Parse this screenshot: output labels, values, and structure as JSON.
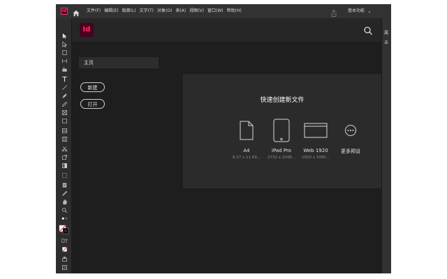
{
  "menubar": {
    "app_icon": "Id",
    "home_icon": "home-icon",
    "menus": [
      "文件(F)",
      "编辑(E)",
      "版面(L)",
      "文字(T)",
      "对象(O)",
      "表(A)",
      "视图(V)",
      "窗口(W)",
      "帮助(H)"
    ],
    "share_icon": "share-icon",
    "workspace": "基本功能",
    "workspace_chevron": "⌄"
  },
  "header": {
    "logo": "Id",
    "search_icon": "search-icon"
  },
  "right_panel": {
    "line1": "属",
    "line2": "未"
  },
  "sidebar": {
    "home_label": "主页",
    "new_button": "新建",
    "open_button": "打开"
  },
  "quick_create": {
    "title": "快速创建新文件",
    "presets": [
      {
        "name": "A4",
        "size": "8.27 x 11.69...",
        "icon": "page-icon"
      },
      {
        "name": "iPad Pro",
        "size": "2732 x 2048...",
        "icon": "tablet-icon"
      },
      {
        "name": "Web 1920",
        "size": "1920 x 1080...",
        "icon": "browser-icon"
      },
      {
        "name": "更多预设",
        "size": "",
        "icon": "more-icon"
      }
    ]
  },
  "colors": {
    "window_bg": "#1e1e1e",
    "menubar_bg": "#323232",
    "panel_bg": "#2b2b2b",
    "brand": "#ff3366",
    "brand_bg": "#49021f"
  }
}
